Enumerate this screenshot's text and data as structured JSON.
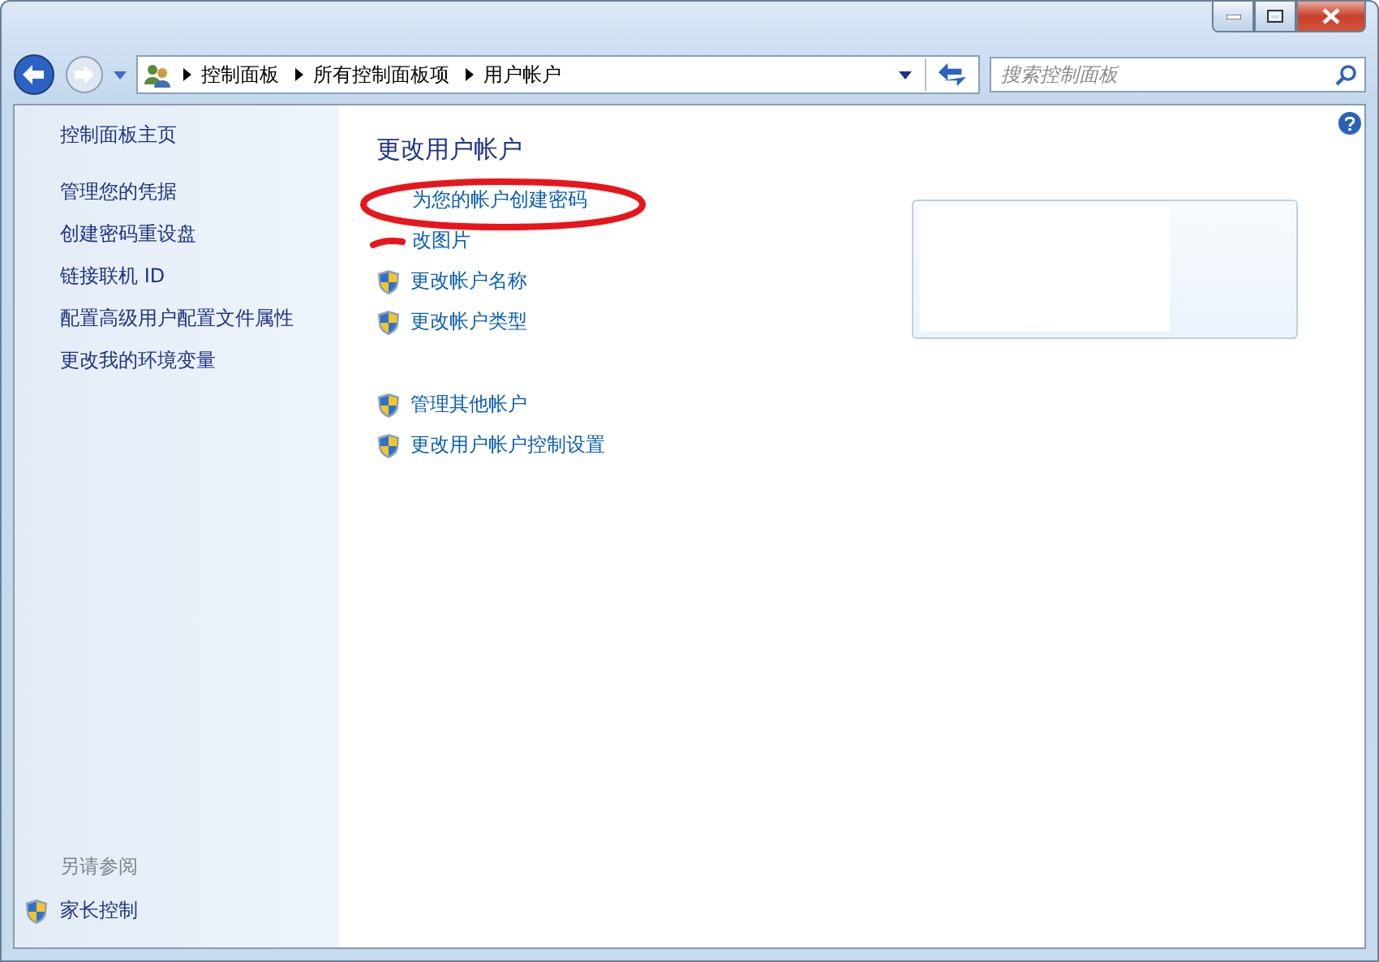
{
  "address_bar": {
    "crumbs": [
      "控制面板",
      "所有控制面板项",
      "用户帐户"
    ]
  },
  "search": {
    "placeholder": "搜索控制面板"
  },
  "sidebar": {
    "items": [
      "控制面板主页",
      "管理您的凭据",
      "创建密码重设盘",
      "链接联机 ID",
      "配置高级用户配置文件属性",
      "更改我的环境变量"
    ],
    "see_also_title": "另请参阅",
    "see_also": [
      {
        "label": "家长控制",
        "shield": true
      }
    ]
  },
  "main": {
    "title": "更改用户帐户",
    "task_groups": [
      [
        {
          "label": "为您的帐户创建密码",
          "shield": false
        },
        {
          "label": "改图片",
          "shield": false
        },
        {
          "label": "更改帐户名称",
          "shield": true
        },
        {
          "label": "更改帐户类型",
          "shield": true
        }
      ],
      [
        {
          "label": "管理其他帐户",
          "shield": true
        },
        {
          "label": "更改用户帐户控制设置",
          "shield": true
        }
      ]
    ]
  }
}
